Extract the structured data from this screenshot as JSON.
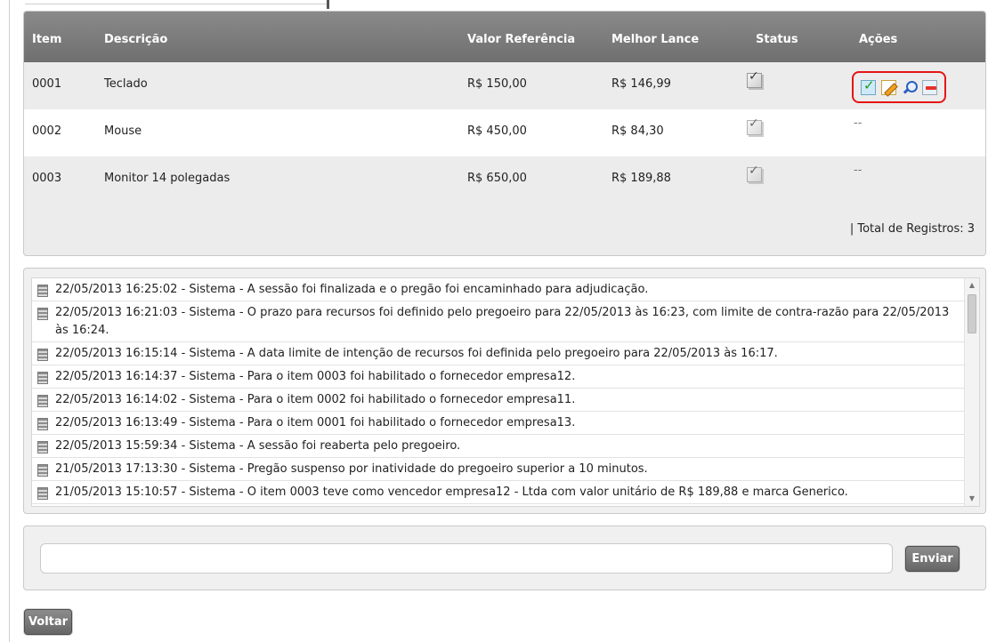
{
  "table": {
    "headers": {
      "item": "Item",
      "descricao": "Descrição",
      "valor_referencia": "Valor Referência",
      "melhor_lance": "Melhor Lance",
      "status": "Status",
      "acoes": "Ações"
    },
    "rows": [
      {
        "item": "0001",
        "descricao": "Teclado",
        "valor_referencia": "R$ 150,00",
        "melhor_lance": "R$ 146,99",
        "status_icon": "checklist-icon",
        "acoes": "icons"
      },
      {
        "item": "0002",
        "descricao": "Mouse",
        "valor_referencia": "R$ 450,00",
        "melhor_lance": "R$ 84,30",
        "status_icon": "checklist-icon",
        "acoes": "--"
      },
      {
        "item": "0003",
        "descricao": "Monitor 14 polegadas",
        "valor_referencia": "R$ 650,00",
        "melhor_lance": "R$ 189,88",
        "status_icon": "checklist-icon",
        "acoes": "--"
      }
    ],
    "action_icons": [
      "approve-icon",
      "edit-icon",
      "zoom-icon",
      "remove-icon"
    ],
    "total": "| Total de Registros: 3"
  },
  "log": [
    "22/05/2013 16:25:02 - Sistema - A sessão foi finalizada e o pregão foi encaminhado para adjudicação.",
    "22/05/2013 16:21:03 - Sistema - O prazo para recursos foi definido pelo pregoeiro para 22/05/2013 às 16:23, com limite de contra-razão para 22/05/2013 às 16:24.",
    "22/05/2013 16:15:14 - Sistema - A data limite de intenção de recursos foi definida pelo pregoeiro para 22/05/2013 às 16:17.",
    "22/05/2013 16:14:37 - Sistema - Para o item 0003 foi habilitado o fornecedor empresa12.",
    "22/05/2013 16:14:02 - Sistema - Para o item 0002 foi habilitado o fornecedor empresa11.",
    "22/05/2013 16:13:49 - Sistema - Para o item 0001 foi habilitado o fornecedor empresa13.",
    "22/05/2013 15:59:34 - Sistema - A sessão foi reaberta pelo pregoeiro.",
    "21/05/2013 17:13:30 - Sistema - Pregão suspenso por inatividade do pregoeiro superior a 10 minutos.",
    "21/05/2013 15:10:57 - Sistema - O item 0003 teve como vencedor empresa12 - Ltda com valor unitário de R$ 189,88 e marca Generico."
  ],
  "chat": {
    "input_value": "",
    "send_label": "Enviar"
  },
  "nav": {
    "back_label": "Voltar"
  },
  "colors": {
    "header_bg": "#777777",
    "highlight_border": "#e51515",
    "button_bg": "#777777"
  }
}
